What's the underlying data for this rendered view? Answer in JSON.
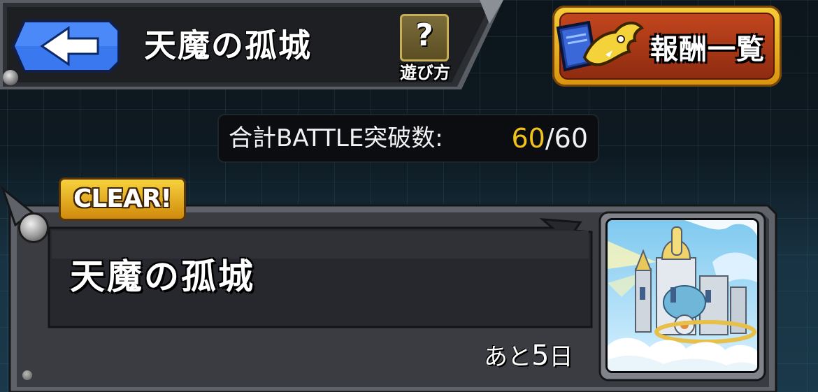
{
  "header": {
    "back_label": "",
    "title": "天魔の孤城",
    "help_icon": "?",
    "help_label": "遊び方"
  },
  "reward_button": {
    "label": "報酬一覧",
    "icon": "book-dragon-icon"
  },
  "battle_counter": {
    "label": "合計BATTLE突破数:",
    "current": "60",
    "separator": "/",
    "total": "60",
    "current_color": "#f0c21a"
  },
  "stage_card": {
    "badge": "CLEAR!",
    "name": "天魔の孤城",
    "remaining_prefix": "あと",
    "remaining_days": "5",
    "remaining_suffix": "日",
    "thumbnail_icon": "castle-in-clouds-icon"
  },
  "colors": {
    "back_button": "#2f6ee8",
    "badge_gold": "#f2c532",
    "reward_red": "#b43d19"
  }
}
